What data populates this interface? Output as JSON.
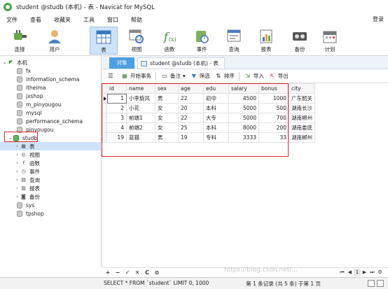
{
  "window": {
    "title": "student @studb (本机) - 表 - Navicat for MySQL"
  },
  "menu": {
    "items": [
      "文件",
      "查看",
      "收藏夹",
      "工具",
      "窗口",
      "帮助"
    ],
    "login": "登录"
  },
  "toolbar": {
    "buttons": [
      "连接",
      "用户",
      "表",
      "视图",
      "函数",
      "事件",
      "查询",
      "报表",
      "备份",
      "计划"
    ],
    "active": "表"
  },
  "sidebar": {
    "connection": "本机",
    "databases_before": [
      "fx",
      "information_schema",
      "itheima",
      "jxshop",
      "m_pinyougou",
      "mysql",
      "performance_schema",
      "pinyougou"
    ],
    "open_db": "studb",
    "open_db_children": [
      "表",
      "视图",
      "函数",
      "事件",
      "查询",
      "报表",
      "备份"
    ],
    "databases_after": [
      "sys",
      "tpshop"
    ]
  },
  "tabs": {
    "objects": "对象",
    "table_tab": "student @studb (本机) - 表"
  },
  "subtoolbar": {
    "begin_tx": "开始事务",
    "memo": "备注",
    "filter": "筛选",
    "sort": "排序",
    "import": "导入",
    "export": "导出"
  },
  "grid": {
    "columns": [
      "id",
      "name",
      "sex",
      "age",
      "edu",
      "salary",
      "bonus",
      "city"
    ],
    "rows": [
      [
        "1",
        "小李旋风",
        "男",
        "22",
        "初中",
        "4500",
        "1000",
        "广东韶关"
      ],
      [
        "2",
        "小花",
        "女",
        "20",
        "本科",
        "5000",
        "500",
        "湖南长沙"
      ],
      [
        "3",
        "前端1",
        "女",
        "22",
        "大专",
        "5000",
        "700",
        "湖南郴州"
      ],
      [
        "4",
        "前端2",
        "女",
        "25",
        "本科",
        "8000",
        "200",
        "湖南娄底"
      ],
      [
        "19",
        "蓝猫",
        "男",
        "19",
        "专科",
        "3333",
        "33",
        "湖南郴州"
      ]
    ]
  },
  "bottom": {
    "add": "+",
    "remove": "−",
    "confirm": "✓",
    "cancel": "✕",
    "refresh": "C",
    "stop": "⊘",
    "page": "1"
  },
  "status": {
    "sql": "SELECT * FROM `student` LIMIT 0, 1000",
    "records": "第 1 条记录 (共 5 条) 于第 1 页",
    "watermark": "https://blog.csdn.net/..."
  },
  "colors": {
    "accent": "#4e9fe0",
    "highlight": "#e02a2a",
    "active_toolbar": "#cfe3f7"
  },
  "icons": {
    "connection": "plug-icon",
    "user": "user-icon",
    "table": "table-icon",
    "view": "view-icon",
    "function": "function-icon",
    "event": "event-icon",
    "query": "query-icon",
    "report": "report-icon",
    "backup": "backup-icon",
    "schedule": "calendar-icon"
  }
}
